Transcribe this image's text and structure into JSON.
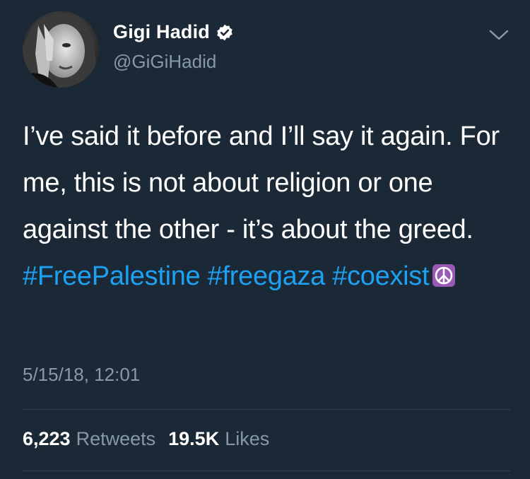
{
  "user": {
    "display_name": "Gigi Hadid",
    "handle": "@GiGiHadid",
    "verified": true,
    "avatar_icon": "profile-photo"
  },
  "tweet": {
    "text_plain": "I’ve said it before and I’ll say it again. For me, this is not about religion or one against the other - it’s about the greed.",
    "hashtags": [
      "#FreePalestine",
      "#freegaza",
      "#coexist"
    ],
    "emoji": "peace-symbol-icon",
    "timestamp": "5/15/18, 12:01"
  },
  "stats": {
    "retweets_count": "6,223",
    "retweets_label": "Retweets",
    "likes_count": "19.5K",
    "likes_label": "Likes"
  },
  "colors": {
    "background": "#1b2836",
    "text": "#ffffff",
    "muted": "#8899a6",
    "link": "#1da1f2",
    "verified": "#ffffff",
    "emoji_bg": "#9b59b6"
  }
}
